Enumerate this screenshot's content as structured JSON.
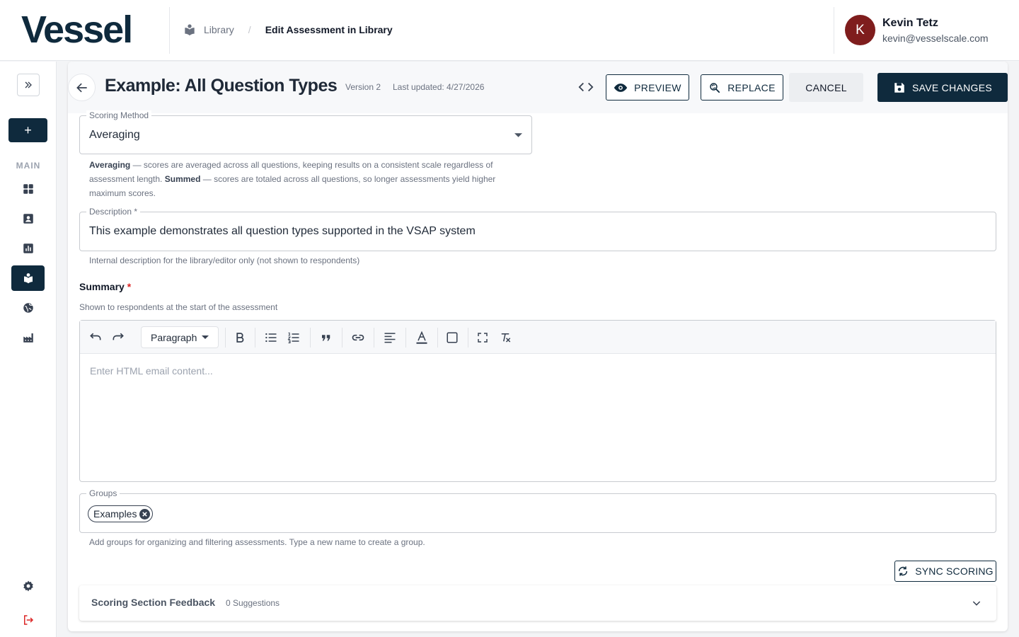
{
  "header": {
    "logo": "Vessel",
    "breadcrumb": {
      "library": "Library",
      "separator": "/",
      "current": "Edit Assessment in Library"
    },
    "user": {
      "initial": "K",
      "name": "Kevin Tetz",
      "email": "kevin@vesselscale.com",
      "avatar_color": "#7f1d1d"
    }
  },
  "sidebar": {
    "add_label": "+",
    "section_label": "MAIN",
    "items": [
      {
        "name": "dashboard-icon"
      },
      {
        "name": "contacts-icon"
      },
      {
        "name": "analytics-icon"
      },
      {
        "name": "library-icon",
        "active": true
      },
      {
        "name": "globe-icon"
      },
      {
        "name": "factory-icon"
      }
    ],
    "bottom": [
      {
        "name": "gear-icon"
      },
      {
        "name": "logout-icon"
      }
    ]
  },
  "actions": {
    "title": "Example: All Question Types",
    "version": "Version 2",
    "last_updated": "Last updated: 4/27/2026",
    "preview": "PREVIEW",
    "replace": "REPLACE",
    "cancel": "CANCEL",
    "save": "SAVE CHANGES"
  },
  "form": {
    "scoring_method": {
      "label": "Scoring Method",
      "value": "Averaging",
      "help_avg_term": "Averaging",
      "help_avg_text": " — scores are averaged across all questions, keeping results on a consistent scale regardless of assessment length. ",
      "help_sum_term": "Summed",
      "help_sum_text": " — scores are totaled across all questions, so longer assessments yield higher maximum scores."
    },
    "description": {
      "label": "Description",
      "required_mark": " *",
      "value": "This example demonstrates all question types supported in the VSAP system",
      "help": "Internal description for the library/editor only (not shown to respondents)"
    },
    "summary": {
      "label": "Summary",
      "required_mark": " *",
      "help": "Shown to respondents at the start of the assessment",
      "paragraph": "Paragraph",
      "placeholder": "Enter HTML email content..."
    },
    "groups": {
      "label": "Groups",
      "chip": "Examples",
      "help": "Add groups for organizing and filtering assessments. Type a new name to create a group."
    },
    "sync_scoring": "SYNC SCORING",
    "feedback": {
      "title": "Scoring Section Feedback",
      "count": "0 Suggestions"
    }
  },
  "colors": {
    "brand": "#0f2a3d",
    "required": "#dc2626",
    "logout": "#dc2626"
  }
}
